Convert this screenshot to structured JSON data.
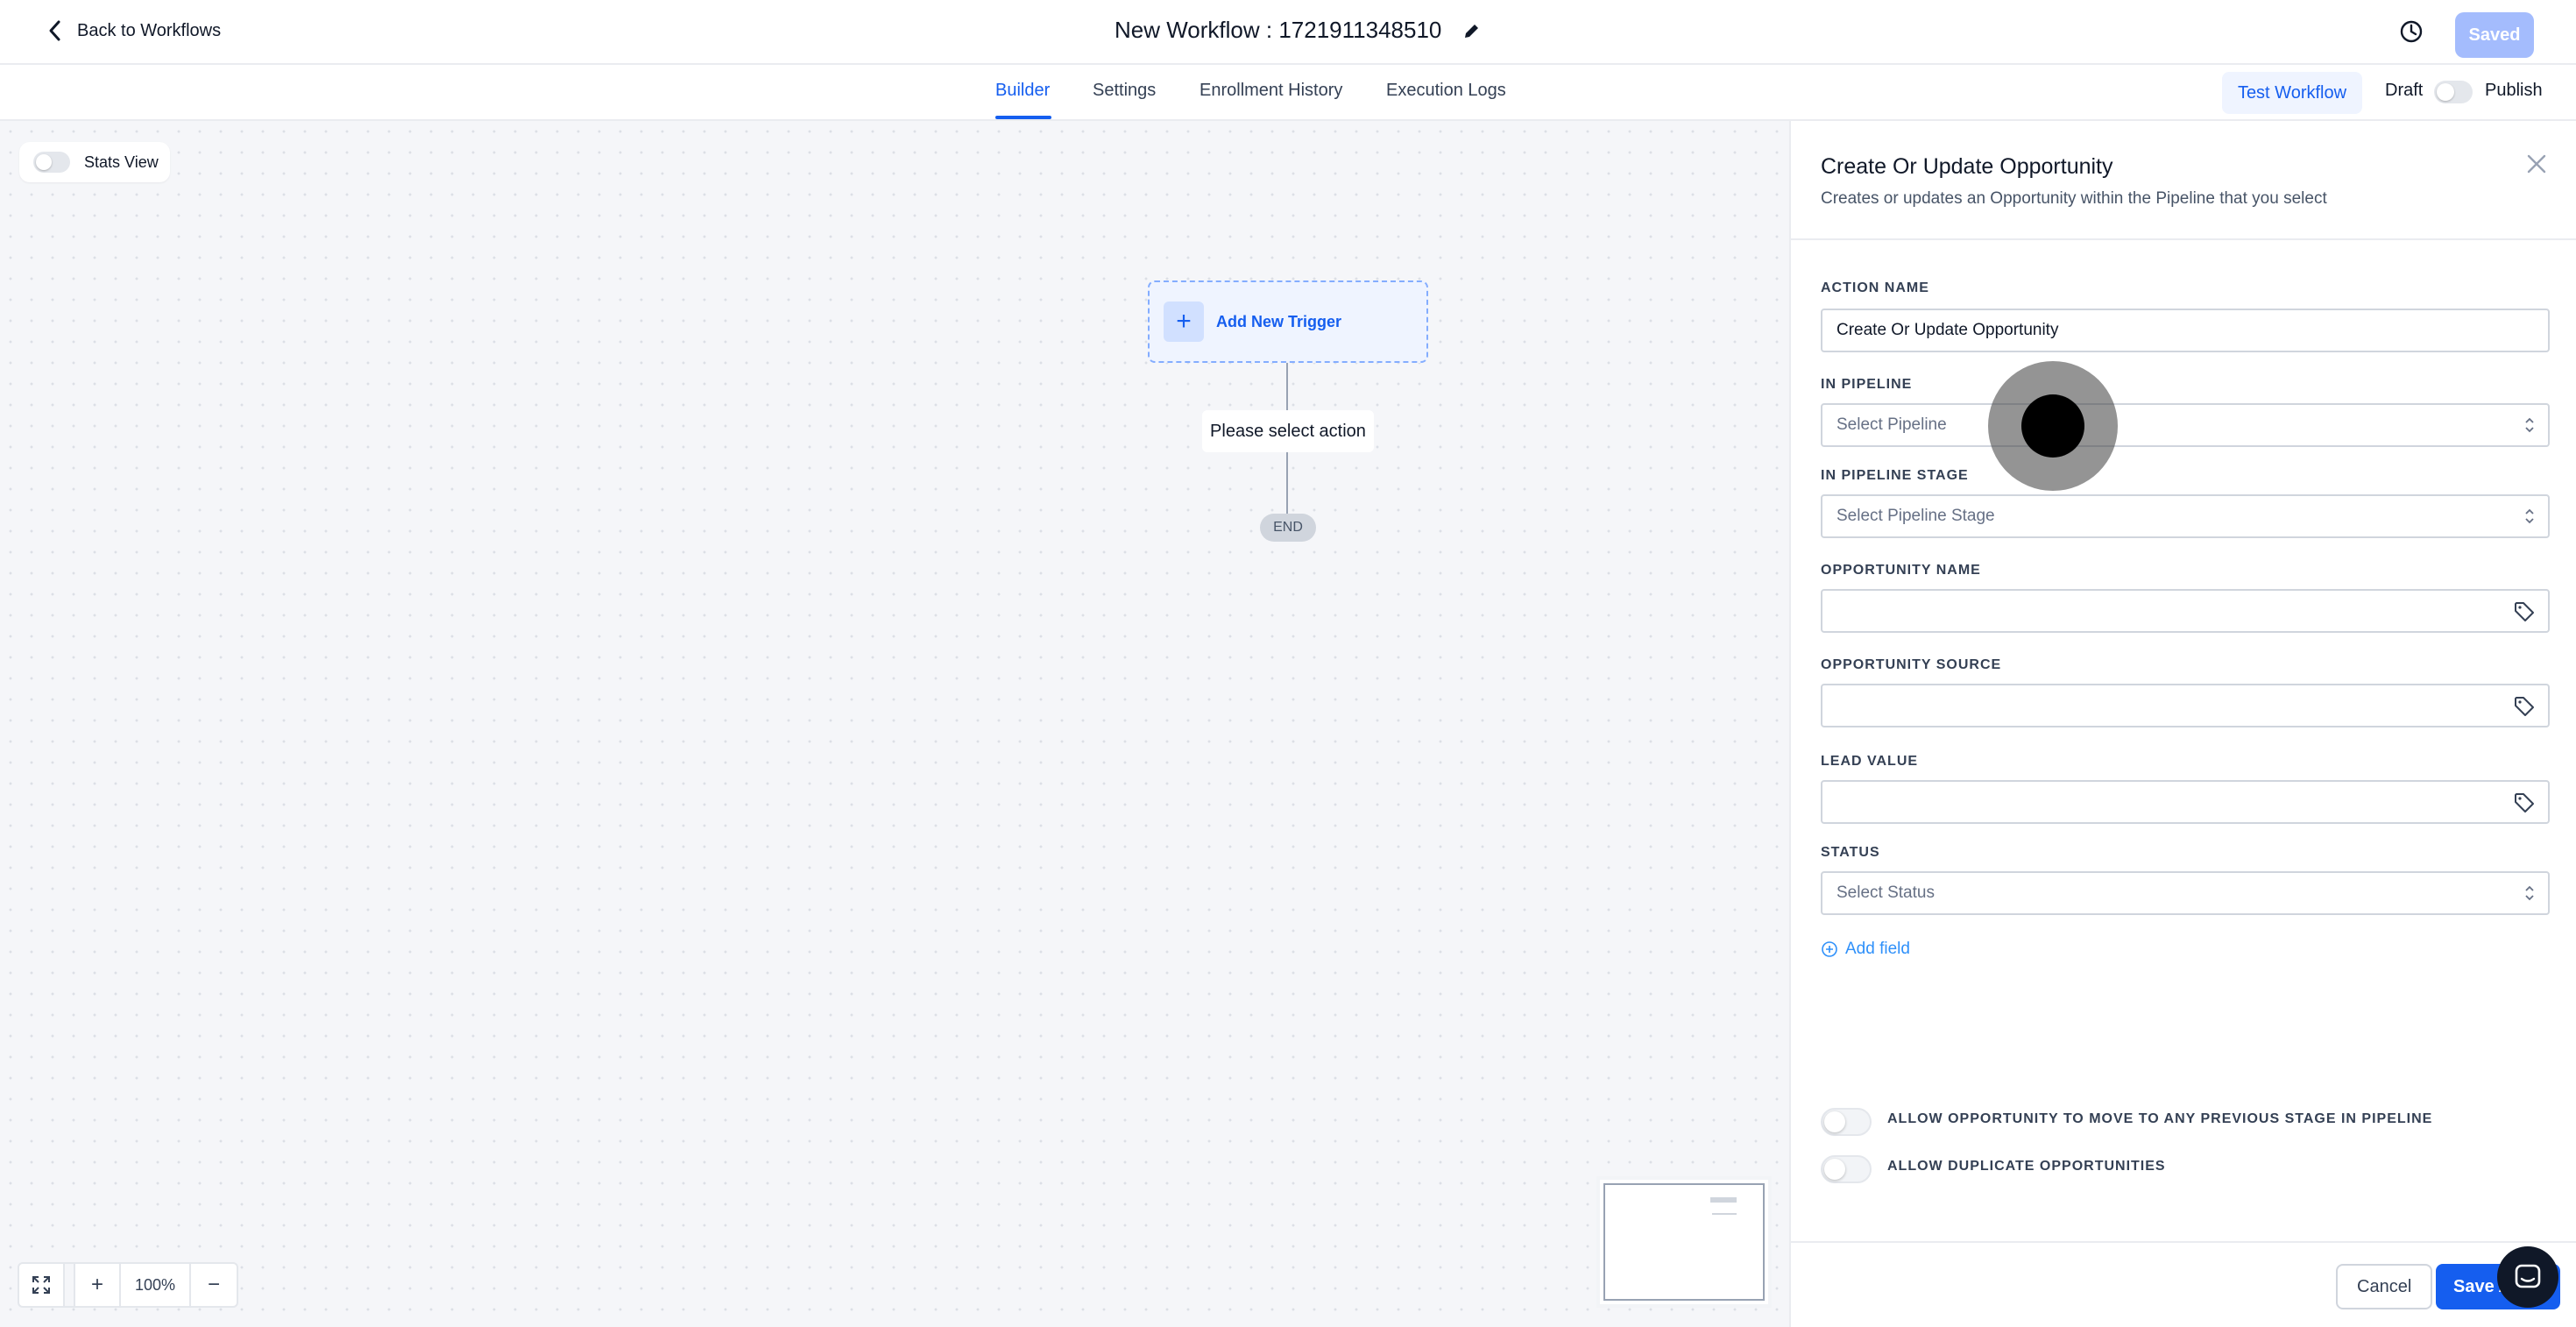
{
  "header": {
    "back_label": "Back to Workflows",
    "workflow_title": "New Workflow : 1721911348510",
    "saved_label": "Saved",
    "accent_color": "#155eef"
  },
  "tabs": {
    "items": [
      {
        "label": "Builder",
        "active": true
      },
      {
        "label": "Settings",
        "active": false
      },
      {
        "label": "Enrollment History",
        "active": false
      },
      {
        "label": "Execution Logs",
        "active": false
      }
    ],
    "test_workflow_label": "Test Workflow",
    "draft_label": "Draft",
    "publish_label": "Publish"
  },
  "canvas": {
    "stats_view_label": "Stats View",
    "add_trigger_label": "Add New Trigger",
    "action_placeholder": "Please select action",
    "end_label": "END",
    "zoom_level": "100%"
  },
  "panel": {
    "title": "Create Or Update Opportunity",
    "description": "Creates or updates an Opportunity within the Pipeline that you select",
    "fields": {
      "action_name": {
        "label": "ACTION NAME",
        "value": "Create Or Update Opportunity"
      },
      "pipeline": {
        "label": "IN PIPELINE",
        "placeholder": "Select Pipeline"
      },
      "pipeline_stage": {
        "label": "IN PIPELINE STAGE",
        "placeholder": "Select Pipeline Stage"
      },
      "opportunity_name": {
        "label": "OPPORTUNITY NAME",
        "value": ""
      },
      "opportunity_source": {
        "label": "OPPORTUNITY SOURCE",
        "value": ""
      },
      "lead_value": {
        "label": "LEAD VALUE",
        "value": ""
      },
      "status": {
        "label": "STATUS",
        "placeholder": "Select Status"
      }
    },
    "add_field_label": "Add field",
    "options": [
      {
        "label": "ALLOW OPPORTUNITY TO MOVE TO ANY PREVIOUS STAGE IN PIPELINE",
        "enabled": false
      },
      {
        "label": "ALLOW DUPLICATE OPPORTUNITIES",
        "enabled": false
      }
    ],
    "cancel_label": "Cancel",
    "save_label": "Save Action"
  }
}
